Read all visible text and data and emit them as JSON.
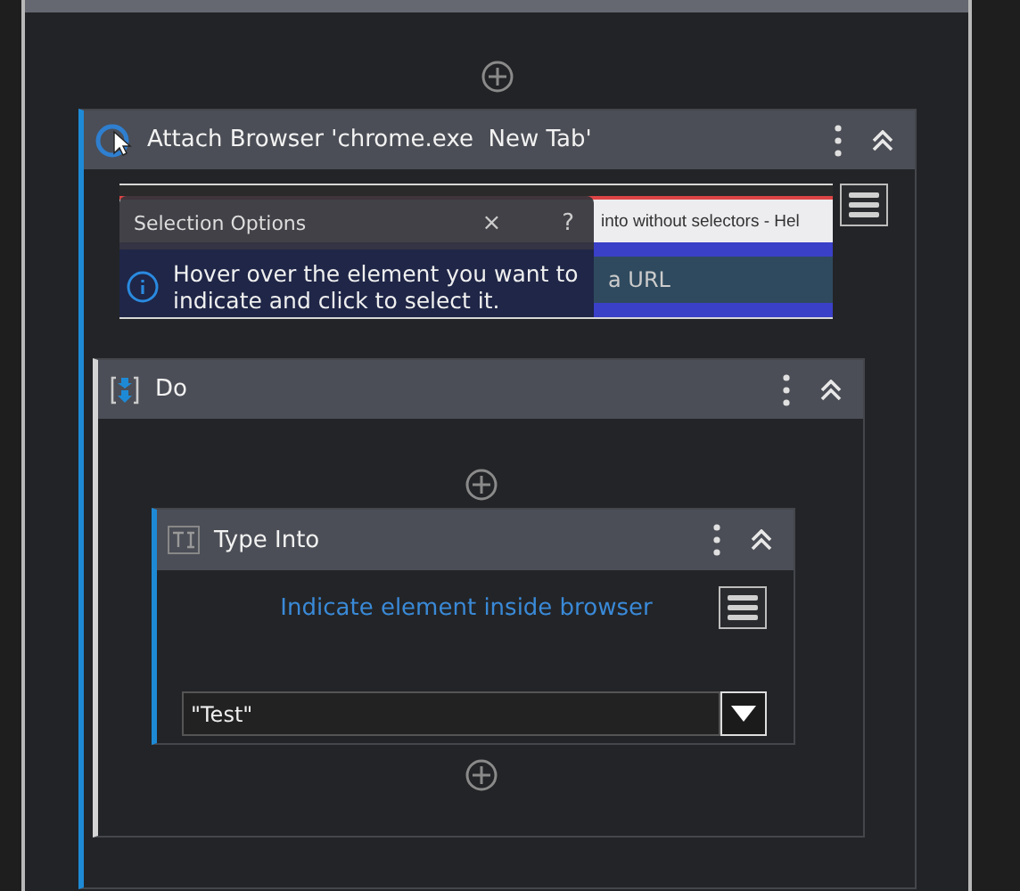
{
  "attach_browser": {
    "title": "Attach Browser 'chrome.exe  New Tab'",
    "preview": {
      "tabs": [
        {
          "label": "into without selectors - Hel"
        }
      ],
      "address": "a URL",
      "popup": {
        "title": "Selection Options",
        "close": "×",
        "help": "?",
        "message": "Hover over the element you want to indicate and click to select it."
      }
    },
    "do": {
      "title": "Do",
      "type_into": {
        "title": "Type Into",
        "target": "Indicate element inside browser",
        "text": "\"Test\""
      }
    }
  }
}
